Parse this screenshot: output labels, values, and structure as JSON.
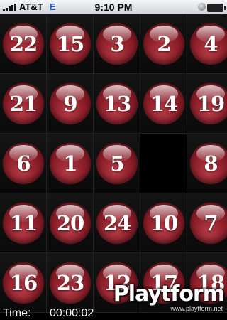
{
  "status_bar": {
    "carrier": "AT&T",
    "network": "E",
    "time": "9:10 PM"
  },
  "board": {
    "tiles": [
      [
        "22",
        "15",
        "3",
        "2",
        "4"
      ],
      [
        "21",
        "9",
        "13",
        "14",
        "19"
      ],
      [
        "6",
        "1",
        "5",
        "",
        "8"
      ],
      [
        "11",
        "20",
        "24",
        "10",
        "7"
      ],
      [
        "16",
        "23",
        "12",
        "17",
        "18"
      ]
    ]
  },
  "timer": {
    "label": "Time:",
    "value": "00:00:02"
  },
  "watermark": {
    "logo": "Playtform",
    "url": "www.playtform.net"
  },
  "colors": {
    "ball": "#8e1f2a",
    "background": "#000000",
    "network": "#1d5fd0"
  }
}
